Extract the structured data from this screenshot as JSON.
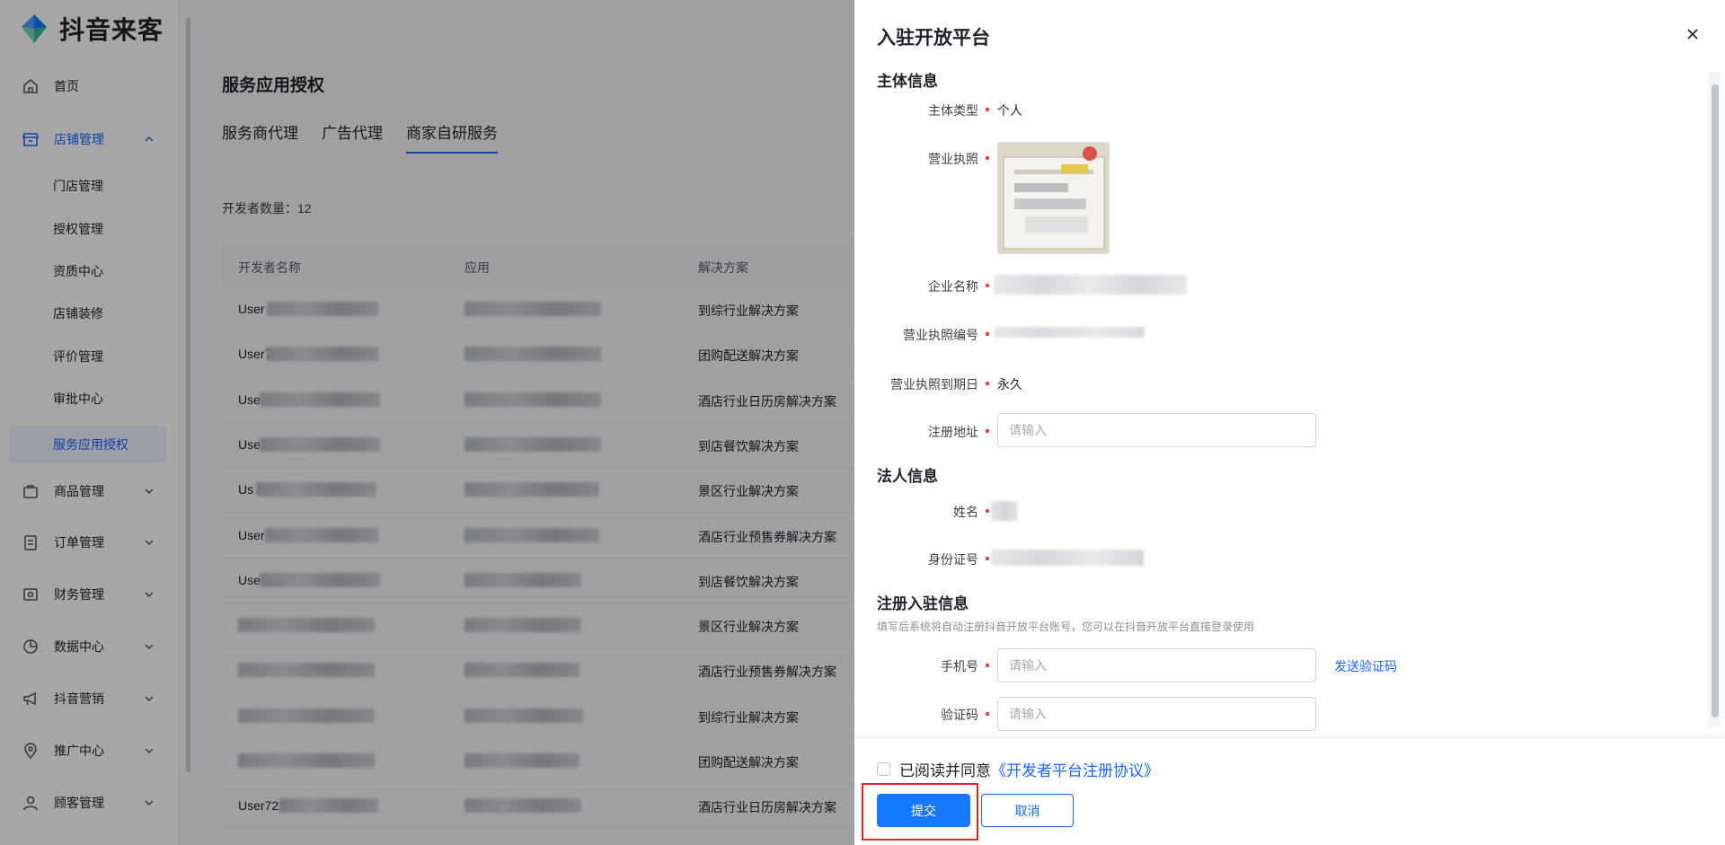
{
  "sidebar": {
    "logo_text": "抖音来客",
    "items": [
      {
        "label": "首页",
        "icon": "home-icon"
      },
      {
        "label": "店铺管理",
        "icon": "store-icon"
      },
      {
        "label": "商品管理",
        "icon": "goods-icon"
      },
      {
        "label": "订单管理",
        "icon": "order-icon"
      },
      {
        "label": "财务管理",
        "icon": "finance-icon"
      },
      {
        "label": "数据中心",
        "icon": "chart-icon"
      },
      {
        "label": "抖音营销",
        "icon": "megaphone-icon"
      },
      {
        "label": "推广中心",
        "icon": "location-icon"
      },
      {
        "label": "顾客管理",
        "icon": "user-icon"
      }
    ],
    "sub_items": [
      "门店管理",
      "授权管理",
      "资质中心",
      "店铺装修",
      "评价管理",
      "审批中心",
      "服务应用授权"
    ]
  },
  "main": {
    "title": "服务应用授权",
    "tabs": [
      "服务商代理",
      "广告代理",
      "商家自研服务"
    ],
    "developer_count": "开发者数量：12",
    "columns": [
      "开发者名称",
      "应用",
      "解决方案"
    ],
    "rows": [
      {
        "dev": "User",
        "solution": "到综行业解决方案"
      },
      {
        "dev": "User7",
        "solution": "团购配送解决方案"
      },
      {
        "dev": "Use",
        "solution": "酒店行业日历房解决方案"
      },
      {
        "dev": "Use",
        "solution": "到店餐饮解决方案"
      },
      {
        "dev": "Us",
        "solution": "景区行业解决方案"
      },
      {
        "dev": "User",
        "solution": "酒店行业预售券解决方案"
      },
      {
        "dev": "Use",
        "solution": "到店餐饮解决方案"
      },
      {
        "dev": "",
        "solution": "景区行业解决方案"
      },
      {
        "dev": "",
        "solution": "酒店行业预售券解决方案"
      },
      {
        "dev": "",
        "solution": "到综行业解决方案"
      },
      {
        "dev": "",
        "solution": "团购配送解决方案"
      },
      {
        "dev": "User721",
        "solution": "酒店行业日历房解决方案"
      }
    ]
  },
  "drawer": {
    "title": "入驻开放平台",
    "section_subject": "主体信息",
    "label_subject_type": "主体类型",
    "value_subject_type": "个人",
    "label_license": "营业执照",
    "label_company": "企业名称",
    "label_license_no": "营业执照编号",
    "label_license_expiry": "营业执照到期日",
    "value_license_expiry": "永久",
    "label_address": "注册地址",
    "placeholder_input": "请输入",
    "section_legal": "法人信息",
    "label_name": "姓名",
    "label_id": "身份证号",
    "section_register": "注册入驻信息",
    "register_hint": "填写后系统将自动注册抖音开放平台账号，您可以在抖音开放平台直接登录使用",
    "label_phone": "手机号",
    "send_code": "发送验证码",
    "label_code": "验证码",
    "agree_text": "已阅读并同意",
    "agree_link": "《开发者平台注册协议》",
    "submit": "提交",
    "cancel": "取消"
  },
  "colors": {
    "accent": "#1966ff",
    "required": "#f53f3f",
    "highlight": "#e5261f"
  }
}
